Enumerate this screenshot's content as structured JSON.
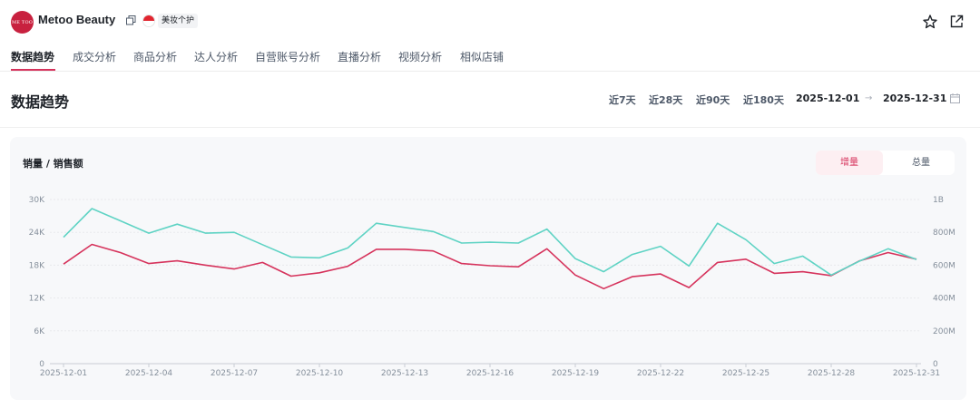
{
  "shop": {
    "logo_text": "ME TOO",
    "name": "Metoo Beauty",
    "category": "美妆个护"
  },
  "tabs": [
    {
      "label": "数据趋势"
    },
    {
      "label": "成交分析"
    },
    {
      "label": "商品分析"
    },
    {
      "label": "达人分析"
    },
    {
      "label": "自营账号分析"
    },
    {
      "label": "直播分析"
    },
    {
      "label": "视频分析"
    },
    {
      "label": "相似店铺"
    }
  ],
  "section": {
    "title": "数据趋势",
    "ranges": [
      "近7天",
      "近28天",
      "近90天",
      "近180天"
    ],
    "start_date": "2025-12-01",
    "end_date": "2025-12-31",
    "arrow": "→"
  },
  "chart_panel": {
    "title": "销量 / 销售额",
    "toggle_active": "增量",
    "toggle_inactive": "总量"
  },
  "colors": {
    "accent": "#d6335c",
    "sales_volume": "#d6335c",
    "sales_amount": "#5fd3c4"
  },
  "chart_data": {
    "type": "line",
    "title": "销量 / 销售额",
    "x": [
      "2025-12-01",
      "2025-12-02",
      "2025-12-03",
      "2025-12-04",
      "2025-12-05",
      "2025-12-06",
      "2025-12-07",
      "2025-12-08",
      "2025-12-09",
      "2025-12-10",
      "2025-12-11",
      "2025-12-12",
      "2025-12-13",
      "2025-12-14",
      "2025-12-15",
      "2025-12-16",
      "2025-12-17",
      "2025-12-18",
      "2025-12-19",
      "2025-12-20",
      "2025-12-21",
      "2025-12-22",
      "2025-12-23",
      "2025-12-24",
      "2025-12-25",
      "2025-12-26",
      "2025-12-27",
      "2025-12-28",
      "2025-12-29",
      "2025-12-30",
      "2025-12-31"
    ],
    "x_tick_labels": [
      "2025-12-01",
      "2025-12-04",
      "2025-12-07",
      "2025-12-10",
      "2025-12-13",
      "2025-12-16",
      "2025-12-19",
      "2025-12-22",
      "2025-12-25",
      "2025-12-28",
      "2025-12-31"
    ],
    "y_left_ticks": [
      "0",
      "6K",
      "12K",
      "18K",
      "24K",
      "30K"
    ],
    "y_right_ticks": [
      "0",
      "200M",
      "400M",
      "600M",
      "800M",
      "1B"
    ],
    "ylim_left": [
      0,
      30000
    ],
    "ylim_right": [
      0,
      1000000000
    ],
    "grid": true,
    "series": [
      {
        "axis": "left",
        "color": "#d6335c",
        "values": [
          18200,
          21800,
          20300,
          18300,
          18800,
          18000,
          17300,
          18500,
          16000,
          16600,
          17800,
          20900,
          20900,
          20600,
          18300,
          17900,
          17700,
          21000,
          16200,
          13700,
          15900,
          16400,
          13900,
          18500,
          19100,
          16500,
          16800,
          16100,
          18800,
          20300,
          19100
        ]
      },
      {
        "axis": "right",
        "color": "#5fd3c4",
        "values": [
          770000000,
          945000000,
          870000000,
          795000000,
          850000000,
          795000000,
          800000000,
          725000000,
          650000000,
          645000000,
          705000000,
          855000000,
          830000000,
          805000000,
          735000000,
          740000000,
          735000000,
          820000000,
          640000000,
          560000000,
          665000000,
          715000000,
          595000000,
          855000000,
          755000000,
          610000000,
          655000000,
          540000000,
          625000000,
          700000000,
          635000000
        ]
      }
    ]
  }
}
